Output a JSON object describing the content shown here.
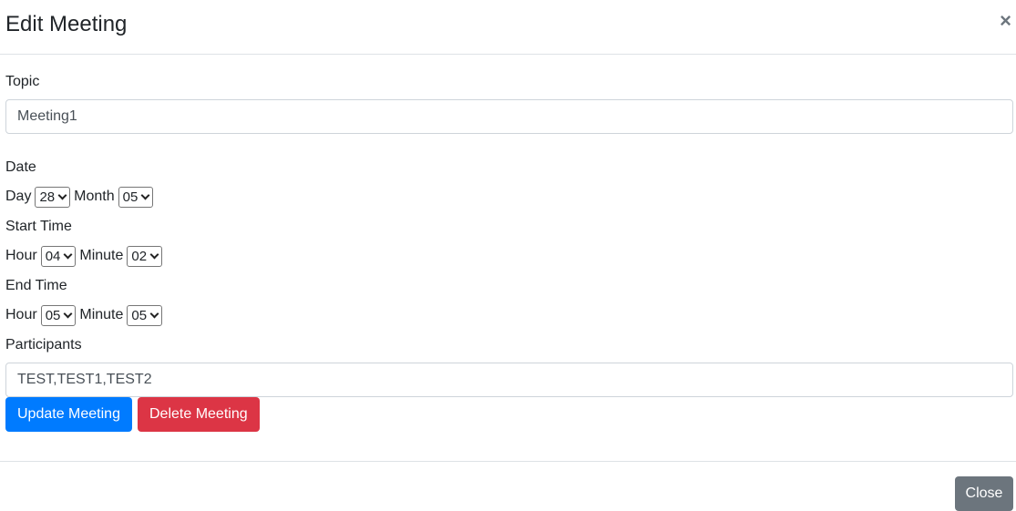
{
  "modal": {
    "title": "Edit Meeting",
    "close_icon": "×"
  },
  "topic": {
    "label": "Topic",
    "value": "Meeting1"
  },
  "date": {
    "label": "Date",
    "day_label": "Day",
    "day_value": "28",
    "month_label": "Month",
    "month_value": "05"
  },
  "start_time": {
    "label": "Start Time",
    "hour_label": "Hour",
    "hour_value": "04",
    "minute_label": "Minute",
    "minute_value": "02"
  },
  "end_time": {
    "label": "End Time",
    "hour_label": "Hour",
    "hour_value": "05",
    "minute_label": "Minute",
    "minute_value": "05"
  },
  "participants": {
    "label": "Participants",
    "value": "TEST,TEST1,TEST2"
  },
  "actions": {
    "update_label": "Update Meeting",
    "delete_label": "Delete Meeting"
  },
  "footer": {
    "close_label": "Close"
  },
  "colors": {
    "primary": "#007bff",
    "danger": "#dc3545",
    "secondary": "#6c757d"
  }
}
